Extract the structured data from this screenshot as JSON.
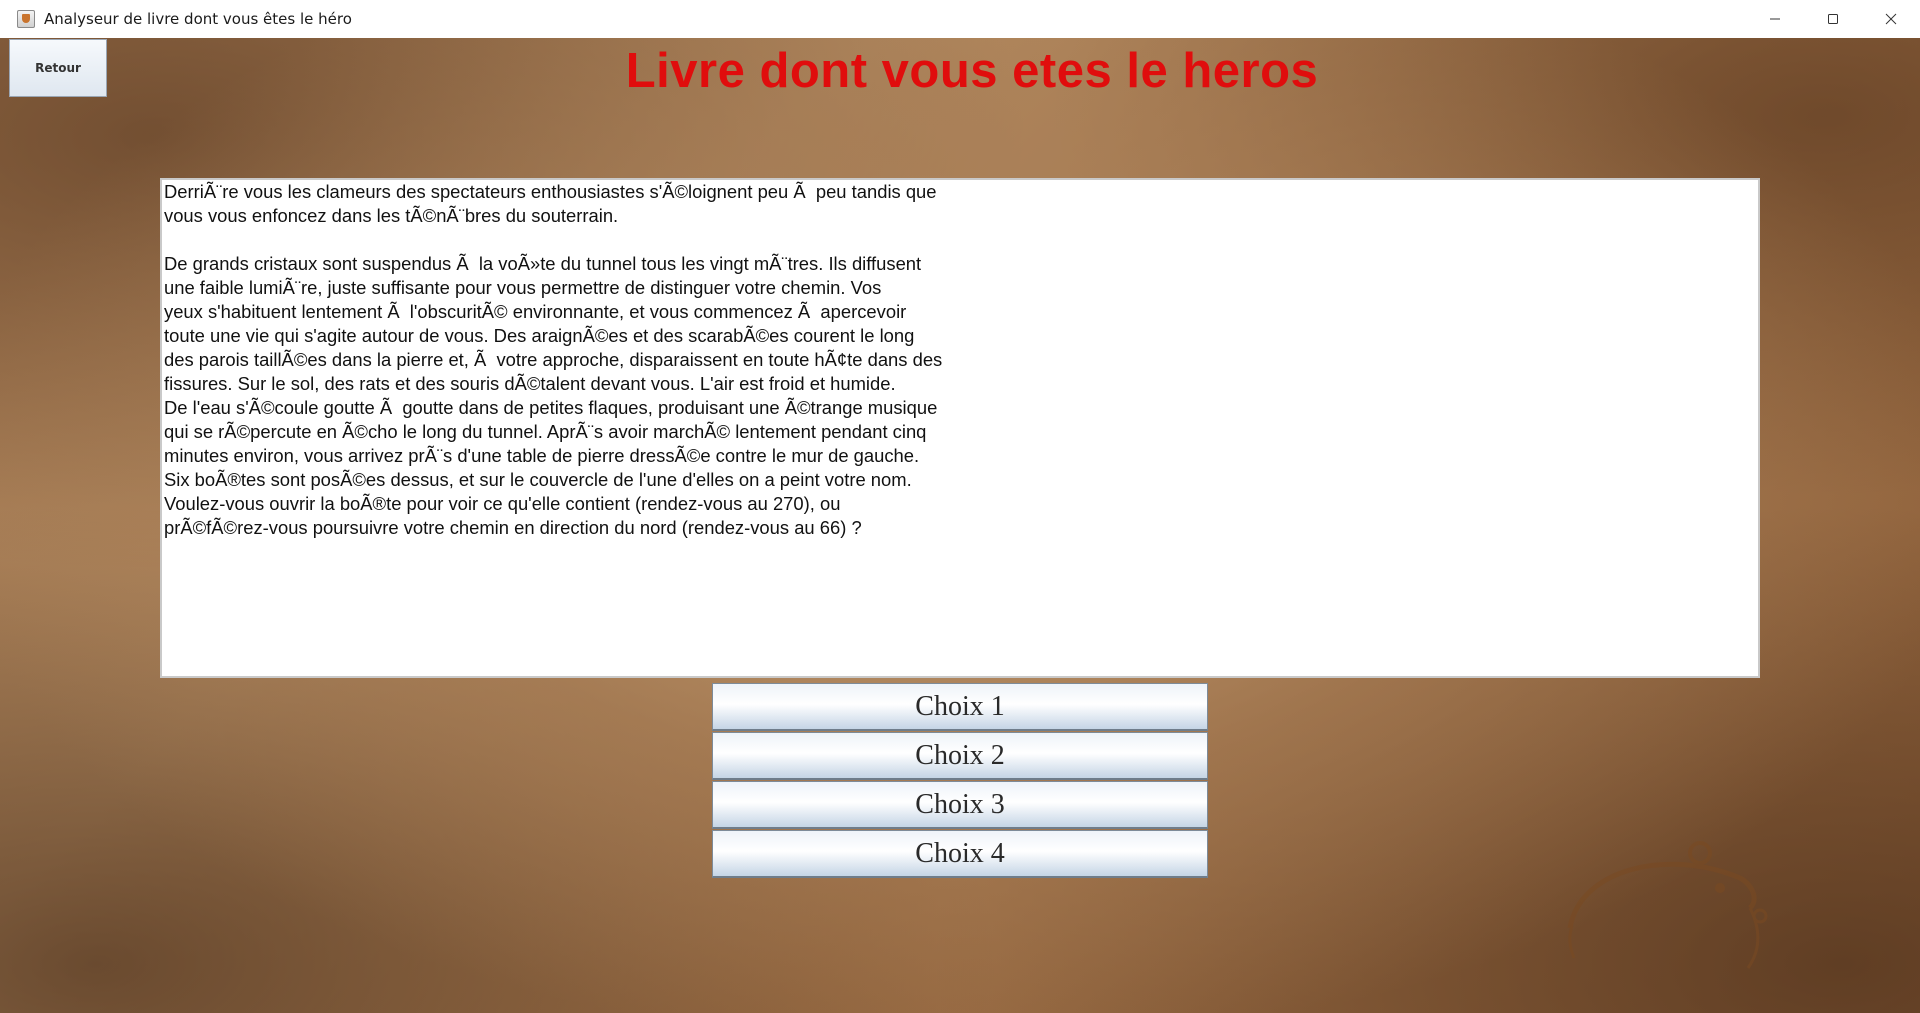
{
  "window": {
    "title": "Analyseur de livre dont vous êtes le héro",
    "controls": [
      "minimize-icon",
      "maximize-icon",
      "close-icon"
    ]
  },
  "header": {
    "back_label": "Retour",
    "title": "Livre dont vous etes le heros",
    "title_color": "#e00d0d"
  },
  "story": {
    "text": "DerriÃ¨re vous les clameurs des spectateurs enthousiastes s'Ã©loignent peu Ã  peu tandis que\nvous vous enfoncez dans les tÃ©nÃ¨bres du souterrain.\n\nDe grands cristaux sont suspendus Ã  la voÃ»te du tunnel tous les vingt mÃ¨tres. Ils diffusent\nune faible lumiÃ¨re, juste suffisante pour vous permettre de distinguer votre chemin. Vos\nyeux s'habituent lentement Ã  l'obscuritÃ© environnante, et vous commencez Ã  apercevoir\ntoute une vie qui s'agite autour de vous. Des araignÃ©es et des scarabÃ©es courent le long\ndes parois taillÃ©es dans la pierre et, Ã  votre approche, disparaissent en toute hÃ¢te dans des\nfissures. Sur le sol, des rats et des souris dÃ©talent devant vous. L'air est froid et humide.\nDe l'eau s'Ã©coule goutte Ã  goutte dans de petites flaques, produisant une Ã©trange musique\nqui se rÃ©percute en Ã©cho le long du tunnel. AprÃ¨s avoir marchÃ© lentement pendant cinq\nminutes environ, vous arrivez prÃ¨s d'une table de pierre dressÃ©e contre le mur de gauche.\nSix boÃ®tes sont posÃ©es dessus, et sur le couvercle de l'une d'elles on a peint votre nom.\nVoulez-vous ouvrir la boÃ®te pour voir ce qu'elle contient (rendez-vous au 270), ou\nprÃ©fÃ©rez-vous poursuivre votre chemin en direction du nord (rendez-vous au 66) ?"
  },
  "choices": [
    {
      "label": "Choix 1"
    },
    {
      "label": "Choix 2"
    },
    {
      "label": "Choix 3"
    },
    {
      "label": "Choix 4"
    }
  ],
  "background": {
    "type": "parchment",
    "accent": "#a67a52"
  }
}
